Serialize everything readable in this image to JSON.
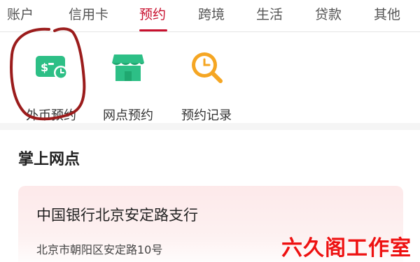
{
  "tabs": [
    {
      "label": "账户"
    },
    {
      "label": "信用卡"
    },
    {
      "label": "预约",
      "active": true
    },
    {
      "label": "跨境"
    },
    {
      "label": "生活"
    },
    {
      "label": "贷款"
    },
    {
      "label": "其他"
    }
  ],
  "shortcuts": [
    {
      "label": "外币预约",
      "icon": "currency-clock-icon"
    },
    {
      "label": "网点预约",
      "icon": "storefront-icon"
    },
    {
      "label": "预约记录",
      "icon": "clock-search-icon"
    }
  ],
  "section": {
    "title": "掌上网点"
  },
  "branch": {
    "name": "中国银行北京安定路支行",
    "address": "北京市朝阳区安定路10号"
  },
  "watermark": "六久阁工作室",
  "colors": {
    "accent": "#c8102e",
    "icon_green": "#2dbf86",
    "icon_orange": "#f5a623",
    "annotation": "#9b1c1c"
  }
}
